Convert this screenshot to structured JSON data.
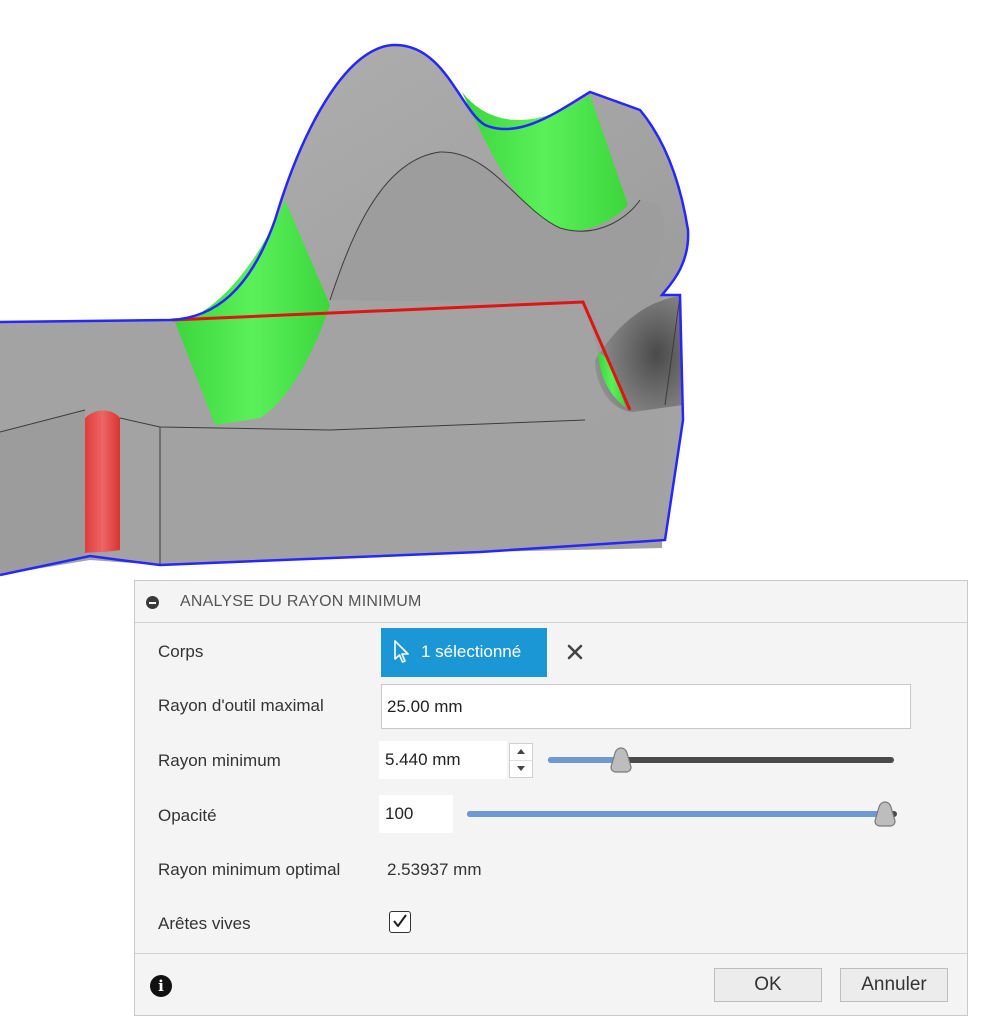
{
  "panel": {
    "title": "ANALYSE DU RAYON MINIMUM",
    "rows": {
      "body": {
        "label": "Corps",
        "selection_label": "1 sélectionné"
      },
      "max_tool_radius": {
        "label": "Rayon d'outil maximal",
        "value": "25.00 mm"
      },
      "min_radius": {
        "label": "Rayon minimum",
        "value": "5.440 mm",
        "slider_fraction": 0.22
      },
      "opacity": {
        "label": "Opacité",
        "value": "100",
        "slider_fraction": 1.0
      },
      "optimal_min_radius": {
        "label": "Rayon minimum optimal",
        "value": "2.53937 mm"
      },
      "sharp_edges": {
        "label": "Arêtes vives",
        "checked": true
      }
    },
    "buttons": {
      "ok": "OK",
      "cancel": "Annuler"
    }
  },
  "colors": {
    "model_gray": "#a4a4a4",
    "highlight_green": "#45e045",
    "highlight_red": "#e84a4a",
    "silhouette_blue": "#2a2aff",
    "select_blue": "#1b97d6",
    "slider_blue": "#6f98d6"
  },
  "icons": [
    "collapse-icon",
    "cursor-icon",
    "close-icon",
    "spinner-up-icon",
    "spinner-down-icon",
    "checkmark-icon",
    "info-icon"
  ]
}
